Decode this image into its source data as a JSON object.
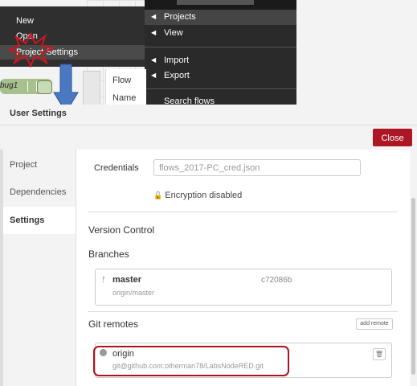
{
  "left_menu": {
    "items": [
      "New",
      "Open",
      "Project Settings"
    ]
  },
  "right_menu": {
    "items": [
      "Projects",
      "View",
      "Import",
      "Export",
      "Search flows"
    ]
  },
  "canvas": {
    "node_label": "bug1",
    "info_rows": [
      "Flow",
      "Name"
    ]
  },
  "dialog": {
    "title": "User Settings",
    "close_label": "Close",
    "tabs": [
      "Project",
      "Dependencies",
      "Settings"
    ],
    "active_tab": "Settings",
    "credentials_label": "Credentials",
    "credentials_value": "flows_2017-PC_cred.json",
    "encryption_text": "Encryption disabled",
    "version_control_title": "Version Control",
    "branches_title": "Branches",
    "branch": {
      "name": "master",
      "hash": "c72086b",
      "tracking": "origin/master"
    },
    "git_remotes_title": "Git remotes",
    "add_remote_label": "add remote",
    "remote": {
      "name": "origin",
      "url": "git@github.com:otherman78/LabsNodeRED.git"
    }
  },
  "colors": {
    "accent_red": "#ad1625",
    "highlight_oval": "#b0111b",
    "node_green": "#a8c08e",
    "arrow_blue": "#4a78c2"
  }
}
